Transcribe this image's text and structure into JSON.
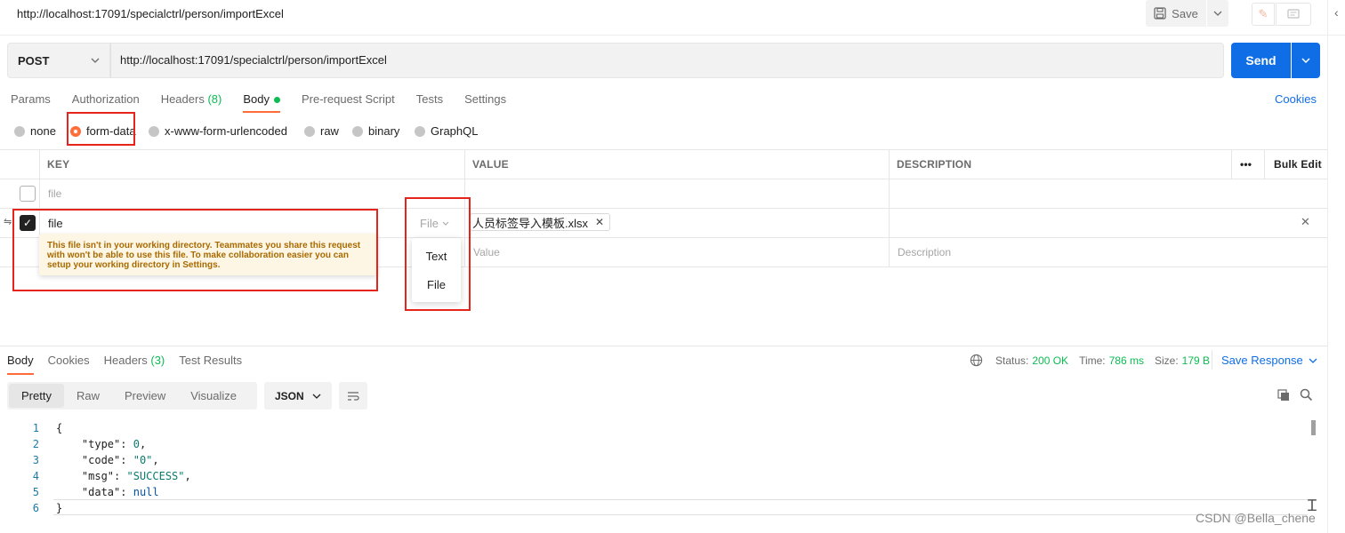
{
  "header": {
    "request_title": "http://localhost:17091/specialctrl/person/importExcel",
    "save_label": "Save",
    "edit_icon": "pencil-icon",
    "comment_icon": "comment-icon"
  },
  "url_bar": {
    "method": "POST",
    "url": "http://localhost:17091/specialctrl/person/importExcel",
    "send_label": "Send"
  },
  "request_tabs": [
    {
      "label": "Params"
    },
    {
      "label": "Authorization"
    },
    {
      "label": "Headers",
      "count": "(8)"
    },
    {
      "label": "Body",
      "active": true
    },
    {
      "label": "Pre-request Script"
    },
    {
      "label": "Tests"
    },
    {
      "label": "Settings"
    }
  ],
  "cookies_label": "Cookies",
  "body_modes": [
    {
      "label": "none"
    },
    {
      "label": "form-data",
      "selected": true
    },
    {
      "label": "x-www-form-urlencoded"
    },
    {
      "label": "raw"
    },
    {
      "label": "binary"
    },
    {
      "label": "GraphQL"
    }
  ],
  "table": {
    "headers": {
      "key": "KEY",
      "value": "VALUE",
      "description": "DESCRIPTION",
      "more": "•••",
      "bulk_edit": "Bulk Edit"
    },
    "rows": [
      {
        "checked": false,
        "key_placeholder": "file"
      },
      {
        "checked": true,
        "key": "file",
        "type": "File",
        "value_file": "人员标签导入模板.xlsx"
      },
      {
        "value_placeholder": "Value",
        "description_placeholder": "Description"
      }
    ],
    "tooltip": "This file isn't in your working directory. Teammates you share this request with won't be able to use this file. To make collaboration easier you can setup your working directory in Settings.",
    "type_menu": [
      "Text",
      "File"
    ]
  },
  "response": {
    "tabs": [
      {
        "label": "Body",
        "active": true
      },
      {
        "label": "Cookies"
      },
      {
        "label": "Headers",
        "count": "(3)"
      },
      {
        "label": "Test Results"
      }
    ],
    "status_label": "Status:",
    "status_value": "200 OK",
    "time_label": "Time:",
    "time_value": "786 ms",
    "size_label": "Size:",
    "size_value": "179 B",
    "save_response_label": "Save Response",
    "view_modes": [
      "Pretty",
      "Raw",
      "Preview",
      "Visualize"
    ],
    "format": "JSON",
    "lines": [
      {
        "n": "1",
        "text": "{"
      },
      {
        "n": "2",
        "k": "\"type\"",
        "v": "0",
        "t": "num",
        "comma": ","
      },
      {
        "n": "3",
        "k": "\"code\"",
        "v": "\"0\"",
        "t": "str",
        "comma": ","
      },
      {
        "n": "4",
        "k": "\"msg\"",
        "v": "\"SUCCESS\"",
        "t": "str",
        "comma": ","
      },
      {
        "n": "5",
        "k": "\"data\"",
        "v": "null",
        "t": "nul",
        "comma": ""
      },
      {
        "n": "6",
        "text": "}"
      }
    ]
  },
  "watermark": "CSDN @Bella_chene",
  "colors": {
    "accent": "#ff6c37",
    "primary": "#0f6ee6",
    "success": "#0cbb52",
    "annotation": "#e5251b"
  }
}
